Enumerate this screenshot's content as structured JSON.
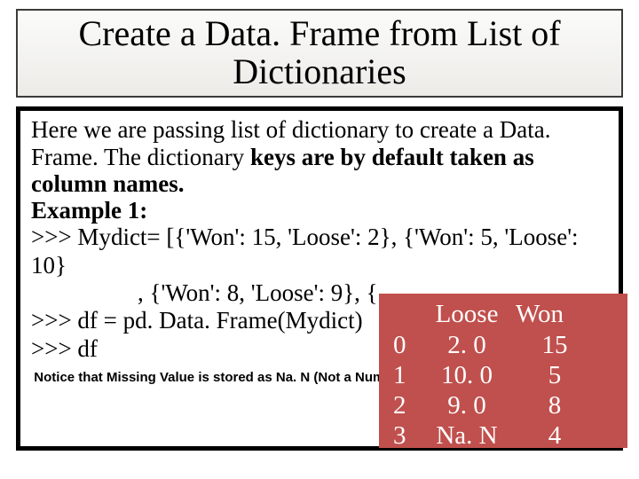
{
  "title": "Create a Data. Frame from List of Dictionaries",
  "body": {
    "intro_plain": "Here we are passing list of dictionary to create a Data. Frame. The dictionary ",
    "intro_bold": "keys are by default taken as column names.",
    "example_label": "Example 1:",
    "code1": ">>> Mydict= [{'Won': 15, 'Loose': 2}, {'Won': 5, 'Loose': 10}",
    "code2": ", {'Won': 8, 'Loose': 9}, {",
    "code3": ">>> df = pd. Data. Frame(Mydict)",
    "code4": ">>> df",
    "note": "Notice that Missing Value is stored as Na. N (Not a Number)"
  },
  "output": {
    "cols": {
      "loose": "Loose",
      "won": "Won"
    },
    "rows": [
      {
        "idx": "0",
        "loose": "2. 0",
        "won": "15"
      },
      {
        "idx": "1",
        "loose": "10. 0",
        "won": "5"
      },
      {
        "idx": "2",
        "loose": "9. 0",
        "won": "8"
      },
      {
        "idx": "3",
        "loose": "Na. N",
        "won": "4"
      }
    ]
  }
}
